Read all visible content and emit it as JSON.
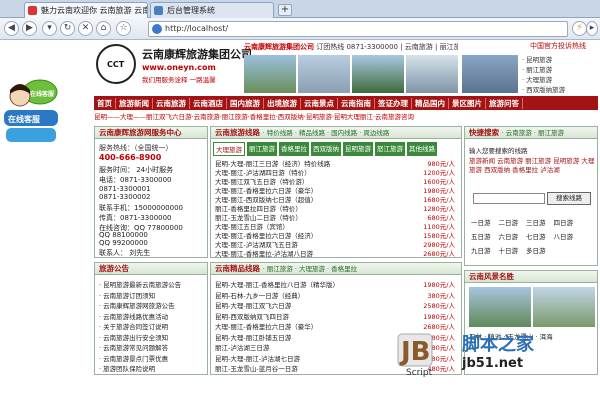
{
  "browser": {
    "tabs": [
      {
        "label": "魅力云南欢迎你 云南旅游 云南..."
      },
      {
        "label": "后台管理系统"
      }
    ],
    "new_tab": "+",
    "address": "http://localhost/"
  },
  "header": {
    "logo_text": "CCT",
    "brand": "云南康辉旅游集团公司",
    "site": "www.oneyn.com",
    "tagline": "我们用服务诠释 一路温馨",
    "hotline_label": "云南康辉旅游集团公司",
    "hotline": "订团热线 0871-3300000",
    "hotline_links": "| 云南旅游 | 丽江旅游 | 云南旅游 |",
    "cn_link": "中国官方投诉热线",
    "side_links": [
      "· 昆明旅游",
      "· 丽江旅游",
      "· 大理旅游",
      "· 西双版纳旅游"
    ]
  },
  "menu": [
    "首页",
    "旅游新闻",
    "云南旅游",
    "云南酒店",
    "国内旅游",
    "出境旅游",
    "云南景点",
    "云南指南",
    "签证办理",
    "精品国内",
    "景区图片",
    "旅游问答"
  ],
  "ticker": "昆明——大理——丽江双飞六日游·云南旅游·丽江旅游·香格里拉·西双版纳·昆明旅游·昆明大理丽江·云南旅游咨询",
  "float_widget": {
    "top": "在线客服",
    "bottom": "在线客服"
  },
  "left_panel": {
    "title": "云南康辉旅游网服务中心",
    "rows": [
      {
        "text": "服务热线：（全国统一）"
      },
      {
        "text": "400-666-8900"
      },
      {
        "text": "服务时间：  24小时服务"
      },
      {
        "text": "电话：0871-3300000"
      },
      {
        "text": "     0871-3300001"
      },
      {
        "text": "     0871-3300002"
      },
      {
        "text": "联系手机：15000000000"
      },
      {
        "text": "传真：0871-3300000"
      },
      {
        "text": "在线咨询：QQ 77800000"
      },
      {
        "text": "          QQ 88100000"
      },
      {
        "text": "          QQ 99200000"
      },
      {
        "text": "联系人：  刘先生"
      }
    ]
  },
  "mid_panel": {
    "title": "云南旅游线路",
    "links": "· 特价线路 · 精品线路 · 国内线路 · 周边线路",
    "subtabs": [
      "大理旅游",
      "丽江旅游",
      "香格里拉",
      "西双版纳",
      "昆明旅游",
      "怒江旅游",
      "其他线路"
    ],
    "items": [
      {
        "title": "昆明-大理-丽江三日游（经济）特价线路",
        "price": "980元/人"
      },
      {
        "title": "大理-丽江-泸沽湖四日游（特价）",
        "price": "1200元/人"
      },
      {
        "title": "大理-丽江双飞五日游（特价游）",
        "price": "1600元/人"
      },
      {
        "title": "大理-丽江-香格里拉六日游（豪华）",
        "price": "1980元/人"
      },
      {
        "title": "大理-丽江-西双版纳七日游（超值）",
        "price": "1680元/人"
      },
      {
        "title": "丽江-香格里拉四日游（特价）",
        "price": "1280元/人"
      },
      {
        "title": "丽江-玉龙雪山二日游（特价）",
        "price": "680元/人"
      },
      {
        "title": "大理-丽江五日游（宾馆）",
        "price": "1100元/人"
      },
      {
        "title": "大理-丽江-香格里拉六日游（经济）",
        "price": "1580元/人"
      },
      {
        "title": "大理-丽江-泸沽湖双飞五日游",
        "price": "2980元/人"
      },
      {
        "title": "大理-丽江-香格里拉-泸沽湖八日游",
        "price": "2680元/人"
      }
    ]
  },
  "right_panel": {
    "title": "快捷搜索",
    "subtitle": "· 云南旅游 · 丽江旅游",
    "hint": "输入您要搜索的线路",
    "tags": [
      "旅游新闻",
      "云南旅游",
      "丽江旅游",
      "昆明旅游",
      "大理旅游",
      "西双版纳",
      "香格里拉",
      "泸沽湖"
    ],
    "search_btn": "搜索线路",
    "days": [
      "一日游",
      "二日游",
      "三日游",
      "四日游",
      "五日游",
      "六日游",
      "七日游",
      "八日游",
      "九日游",
      "十日游",
      "多日游"
    ]
  },
  "news_panel": {
    "title": "旅游公告",
    "items": [
      "· 昆明旅游最新云南旅游公告",
      "· 云南旅游订团须知",
      "· 云南康辉旅游网旅游公告",
      "· 云南旅游线路优惠活动",
      "· 关于旅游合同签订说明",
      "· 云南旅游出行安全须知",
      "· 云南旅游常见问题解答",
      "· 云南旅游景点门票优惠",
      "· 旅游团队保险说明"
    ]
  },
  "bot_panel": {
    "title": "云南精品线路",
    "links": "· 丽江旅游 · 大理旅游 · 香格里拉",
    "items": [
      {
        "title": "昆明-大理-丽江-香格里拉八日游（精华版）",
        "price": "1980元/人"
      },
      {
        "title": "昆明-石林-九乡一日游（经典）",
        "price": "380元/人"
      },
      {
        "title": "昆明-大理-丽江双飞六日游",
        "price": "2580元/人"
      },
      {
        "title": "昆明-西双版纳双飞四日游",
        "price": "1980元/人"
      },
      {
        "title": "大理-丽江-香格里拉六日游（豪华）",
        "price": "2680元/人"
      },
      {
        "title": "昆明-大理-丽江卧铺五日游",
        "price": "1580元/人"
      },
      {
        "title": "丽江-泸沽湖三日游",
        "price": "980元/人"
      },
      {
        "title": "昆明-大理-丽江-泸沽湖七日游",
        "price": "2280元/人"
      },
      {
        "title": "丽江-玉龙雪山-蓝月谷一日游",
        "price": "480元/人"
      }
    ]
  },
  "rb_panel": {
    "title": "云南风景名胜",
    "items": [
      "石林",
      "滇池",
      "玉龙雪山",
      "洱海"
    ]
  },
  "watermark": {
    "cn": "脚本之家",
    "url": "jb51.net",
    "script": "Script"
  }
}
